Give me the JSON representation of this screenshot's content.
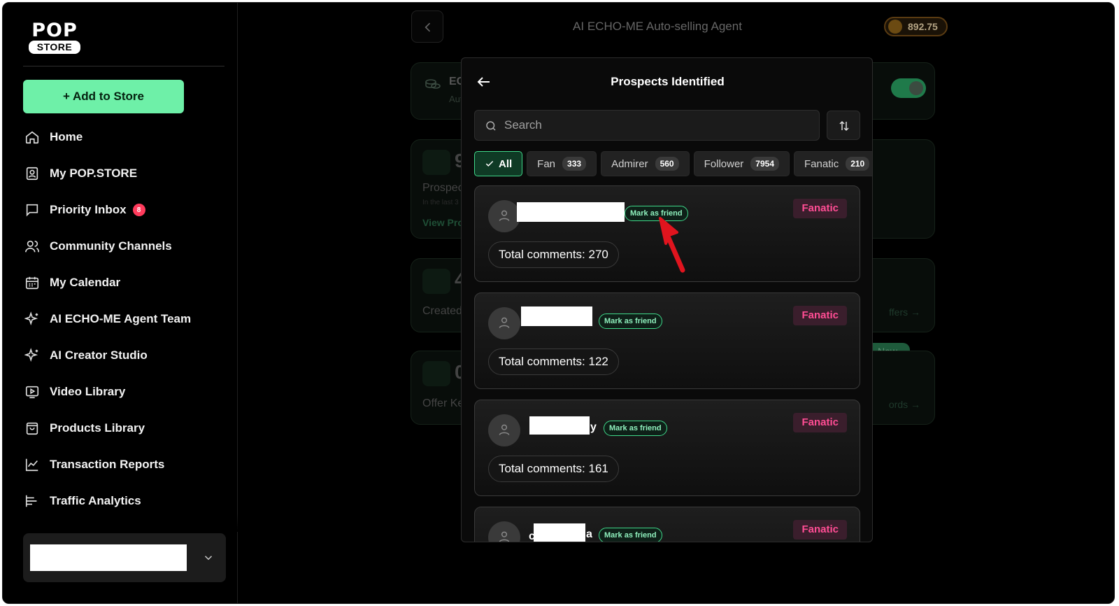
{
  "brand": {
    "logo_top": "POP",
    "logo_bottom": "STORE"
  },
  "sidebar": {
    "add_button": "+ Add to Store",
    "items": [
      {
        "label": "Home",
        "icon": "home-icon"
      },
      {
        "label": "My POP.STORE",
        "icon": "store-profile-icon"
      },
      {
        "label": "Priority Inbox",
        "icon": "chat-icon",
        "badge": "8"
      },
      {
        "label": "Community Channels",
        "icon": "users-icon"
      },
      {
        "label": "My Calendar",
        "icon": "calendar-icon"
      },
      {
        "label": "AI ECHO-ME Agent Team",
        "icon": "sparkle-icon"
      },
      {
        "label": "AI Creator Studio",
        "icon": "sparkle-icon"
      },
      {
        "label": "Video Library",
        "icon": "video-icon"
      },
      {
        "label": "Products Library",
        "icon": "bag-icon"
      },
      {
        "label": "Transaction Reports",
        "icon": "chart-icon"
      },
      {
        "label": "Traffic Analytics",
        "icon": "analytics-icon"
      }
    ]
  },
  "main": {
    "title": "AI ECHO-ME Auto-selling Agent",
    "balance": "892.75",
    "cards": {
      "c1_title": "EC",
      "c1_sub": "Aut",
      "c2_num": "9",
      "c2_label": "Prospect",
      "c2_sub": "In the last 3",
      "c2_link": "View Pros",
      "c3_num": "4",
      "c3_label": "Created",
      "c3_link": "ffers →",
      "c4_num": "0",
      "c4_label": "Offer Ke",
      "c4_link": "ords →",
      "new_badge": "New"
    }
  },
  "modal": {
    "title": "Prospects Identified",
    "search_placeholder": "Search",
    "filters": [
      {
        "label": "All",
        "active": true
      },
      {
        "label": "Fan",
        "count": "333"
      },
      {
        "label": "Admirer",
        "count": "560"
      },
      {
        "label": "Follower",
        "count": "7954"
      },
      {
        "label": "Fanatic",
        "count": "210"
      }
    ],
    "prospects": [
      {
        "name_tail": "",
        "friend_label": "Mark as friend",
        "tag": "Fanatic",
        "comments": "Total comments: 270"
      },
      {
        "name_tail": "",
        "friend_label": "Mark as friend",
        "tag": "Fanatic",
        "comments": "Total comments: 122"
      },
      {
        "name_tail": "y",
        "friend_label": "Mark as friend",
        "tag": "Fanatic",
        "comments": "Total comments: 161"
      },
      {
        "name_tail": "a",
        "name_head": "c",
        "friend_label": "Mark as friend",
        "tag": "Fanatic",
        "comments": ""
      }
    ]
  },
  "colors": {
    "accent": "#6ef0a8",
    "fanatic": "#ff4d94",
    "arrow": "#e0141e"
  }
}
